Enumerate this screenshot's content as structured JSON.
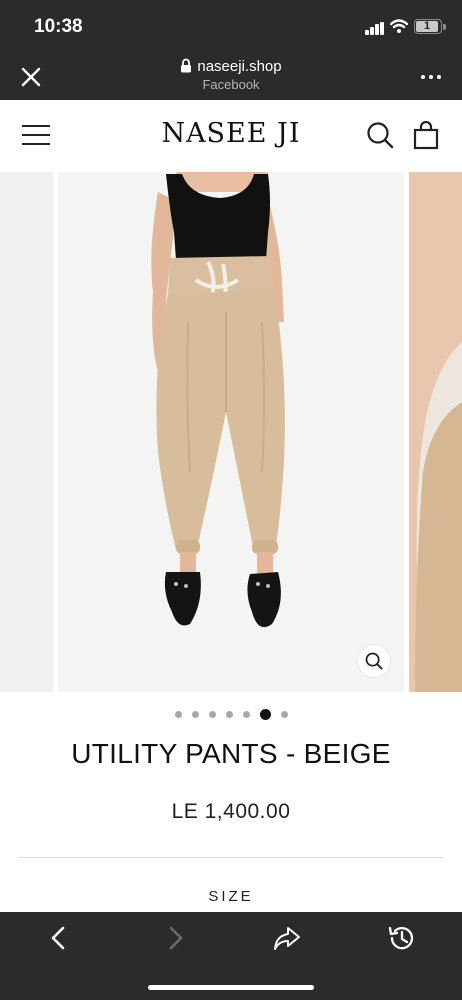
{
  "status_bar": {
    "time": "10:38",
    "battery_level": "1"
  },
  "browser": {
    "domain": "naseeji.shop",
    "source": "Facebook"
  },
  "site": {
    "logo": "NASEE JI"
  },
  "product": {
    "title": "UTILITY PANTS - BEIGE",
    "price": "LE 1,400.00",
    "option_label": "SIZE",
    "image_count": 7,
    "active_image": 6
  },
  "icons": {
    "close": "close-icon",
    "lock": "lock-icon",
    "more": "more-icon",
    "menu": "hamburger-icon",
    "search": "search-icon",
    "cart": "shopping-bag-icon",
    "zoom": "zoom-icon",
    "back": "back-arrow-icon",
    "forward": "forward-arrow-icon",
    "share": "share-icon",
    "history": "history-icon"
  },
  "colors": {
    "chrome": "#2b2b2b",
    "pants": "#d8bd9d",
    "top": "#111111",
    "background": "#f4f4f2"
  }
}
